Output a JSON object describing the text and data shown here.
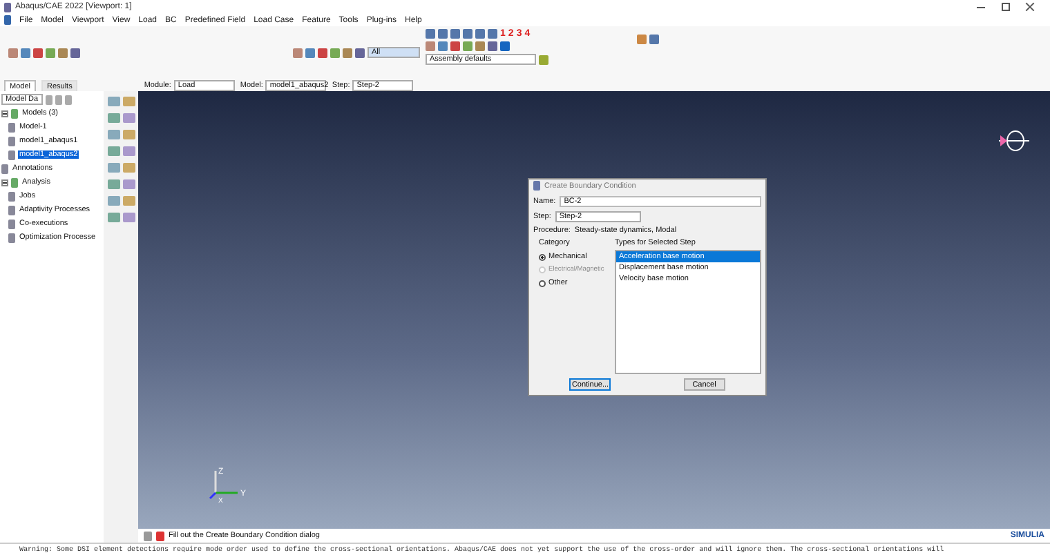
{
  "window": {
    "title": "Abaqus/CAE 2022 [Viewport: 1]"
  },
  "menu": [
    "File",
    "Model",
    "Viewport",
    "View",
    "Load",
    "BC",
    "Predefined Field",
    "Load Case",
    "Feature",
    "Tools",
    "Plug-ins",
    "Help"
  ],
  "view_numbers": [
    "1",
    "2",
    "3",
    "4"
  ],
  "render_style": {
    "value": "Assembly defaults"
  },
  "selection_filter": {
    "value": "All"
  },
  "tabs": [
    {
      "label": "Model",
      "selected": true
    },
    {
      "label": "Results",
      "selected": false
    }
  ],
  "context": [
    {
      "label": "Module:",
      "value": "Load"
    },
    {
      "label": "Model:",
      "value": "model1_abaqus2"
    },
    {
      "label": "Step:",
      "value": "Step-2"
    }
  ],
  "tree_selector": {
    "value": "Model Da"
  },
  "tree": [
    {
      "label": "Models (3)",
      "expanded": true,
      "selected": false,
      "children": [
        {
          "label": "Model-1",
          "selected": false
        },
        {
          "label": "model1_abaqus1",
          "selected": false
        },
        {
          "label": "model1_abaqus2",
          "selected": true
        }
      ]
    },
    {
      "label": "Annotations",
      "selected": false
    },
    {
      "label": "Analysis",
      "expanded": true,
      "selected": false,
      "children": [
        {
          "label": "Jobs",
          "selected": false
        },
        {
          "label": "Adaptivity Processes",
          "selected": false
        },
        {
          "label": "Co-executions",
          "selected": false
        },
        {
          "label": "Optimization Processe",
          "selected": false
        }
      ]
    }
  ],
  "dialog": {
    "title": "Create Boundary Condition",
    "name_label": "Name:",
    "name_value": "BC-2",
    "step_label": "Step:",
    "step_value": "Step-2",
    "procedure_label": "Procedure:",
    "procedure_value": "Steady-state dynamics, Modal",
    "category_label": "Category",
    "categories": [
      {
        "label": "Mechanical",
        "selected": true,
        "disabled": false
      },
      {
        "label": "Electrical/Magnetic",
        "selected": false,
        "disabled": true
      },
      {
        "label": "Other",
        "selected": false,
        "disabled": false
      }
    ],
    "types_label": "Types for Selected Step",
    "types": [
      {
        "label": "Acceleration base motion",
        "selected": true
      },
      {
        "label": "Displacement base motion",
        "selected": false
      },
      {
        "label": "Velocity base motion",
        "selected": false
      }
    ],
    "buttons": [
      "Continue...",
      "Cancel"
    ]
  },
  "triad": {
    "x": "X",
    "y": "Y",
    "z": "Z"
  },
  "prompt": "Fill out the Create Boundary Condition dialog",
  "brand": "SIMULIA",
  "message": "Warning: Some DSI element detections require mode order used to define the cross-sectional orientations. Abaqus/CAE does not yet support the use of the cross-order and will ignore them. The cross-sectional orientations will"
}
